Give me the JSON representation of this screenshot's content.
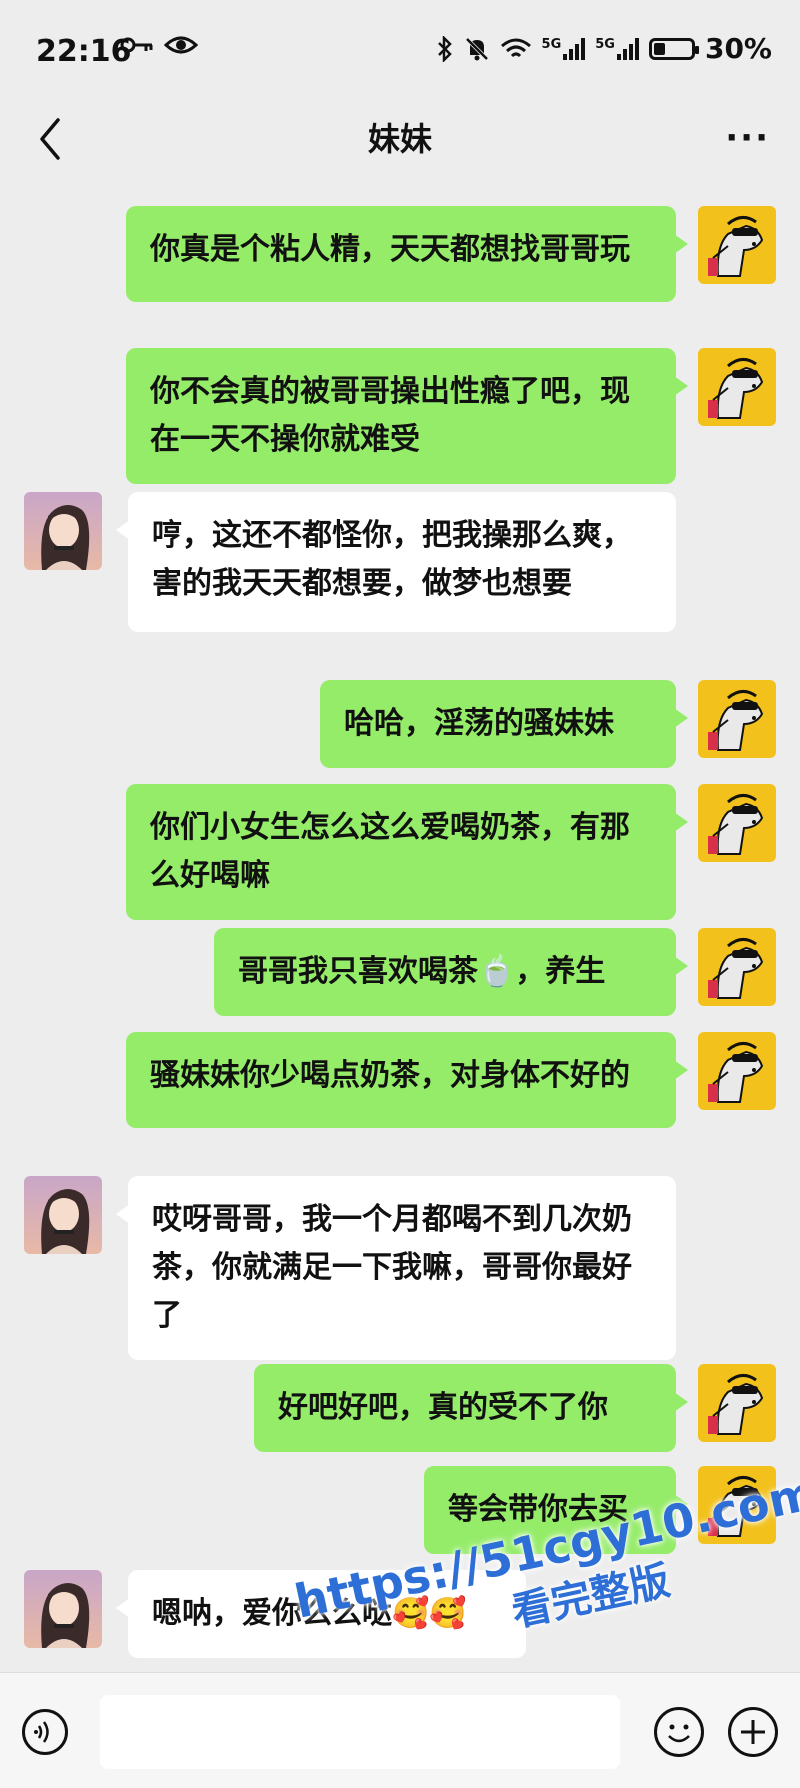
{
  "status_bar": {
    "time": "22:16",
    "signal_1_label": "5G",
    "signal_2_label": "5G",
    "battery_percent": "30%",
    "battery_level": 0.3
  },
  "header": {
    "title": "妹妹",
    "more_label": "···"
  },
  "messages": [
    {
      "side": "right",
      "text": "你真是个粘人精，天天都想找哥哥玩"
    },
    {
      "side": "right",
      "text": "你不会真的被哥哥操出性瘾了吧，现在一天不操你就难受"
    },
    {
      "side": "left",
      "text": "哼，这还不都怪你，把我操那么爽，害的我天天都想要，做梦也想要"
    },
    {
      "side": "right",
      "text": "哈哈，淫荡的骚妹妹"
    },
    {
      "side": "right",
      "text": "你们小女生怎么这么爱喝奶茶，有那么好喝嘛"
    },
    {
      "side": "right",
      "text": "哥哥我只喜欢喝茶🍵，养生"
    },
    {
      "side": "right",
      "text": "骚妹妹你少喝点奶茶，对身体不好的"
    },
    {
      "side": "left",
      "text": "哎呀哥哥，我一个月都喝不到几次奶茶，你就满足一下我嘛，哥哥你最好了"
    },
    {
      "side": "right",
      "text": "好吧好吧，真的受不了你"
    },
    {
      "side": "right",
      "text": "等会带你去买"
    },
    {
      "side": "left",
      "text": "嗯呐，爱你么么哒🥰🥰"
    }
  ],
  "watermark": {
    "url": "https://51cgy10.com",
    "subtitle": "看完整版"
  },
  "colors": {
    "sent_bubble": "#95ec69",
    "received_bubble": "#ffffff",
    "background": "#ededed",
    "watermark": "#2d6fd6"
  },
  "icons": {
    "voice": "voice-icon",
    "emoji": "emoji-icon",
    "plus": "plus-icon",
    "back": "back-chevron-icon"
  }
}
